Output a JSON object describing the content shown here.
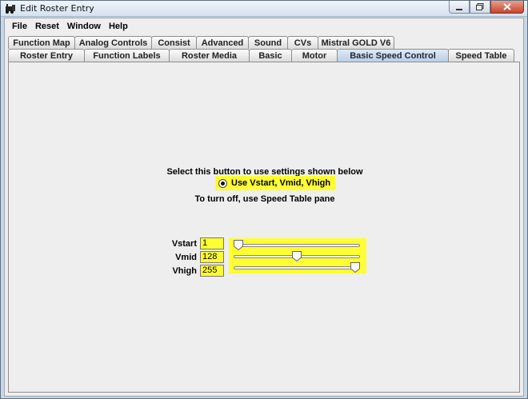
{
  "window": {
    "title": "Edit Roster Entry",
    "icon": "locomotive-icon",
    "controls": {
      "minimize": "minimize-icon",
      "maximize": "maximize-icon",
      "close": "close-icon"
    }
  },
  "menu": [
    "File",
    "Reset",
    "Window",
    "Help"
  ],
  "tabs_back": [
    "Function Map",
    "Analog Controls",
    "Consist",
    "Advanced",
    "Sound",
    "CVs",
    "Mistral GOLD V6"
  ],
  "tabs_front": [
    "Roster Entry",
    "Function Labels",
    "Roster Media",
    "Basic",
    "Motor",
    "Basic Speed Control",
    "Speed Table"
  ],
  "selected_tab": "Basic Speed Control",
  "panel": {
    "instruction": "Select this button to use settings shown below",
    "radio_label": "Use Vstart, Vmid, Vhigh",
    "radio_selected": true,
    "turn_off_text": "To turn off, use Speed Table pane",
    "highlight_color": "#ffff33",
    "fields": [
      {
        "label": "Vstart",
        "value": "1",
        "slider_fraction": 0.0
      },
      {
        "label": "Vmid",
        "value": "128",
        "slider_fraction": 0.5
      },
      {
        "label": "Vhigh",
        "value": "255",
        "slider_fraction": 1.0
      }
    ]
  }
}
